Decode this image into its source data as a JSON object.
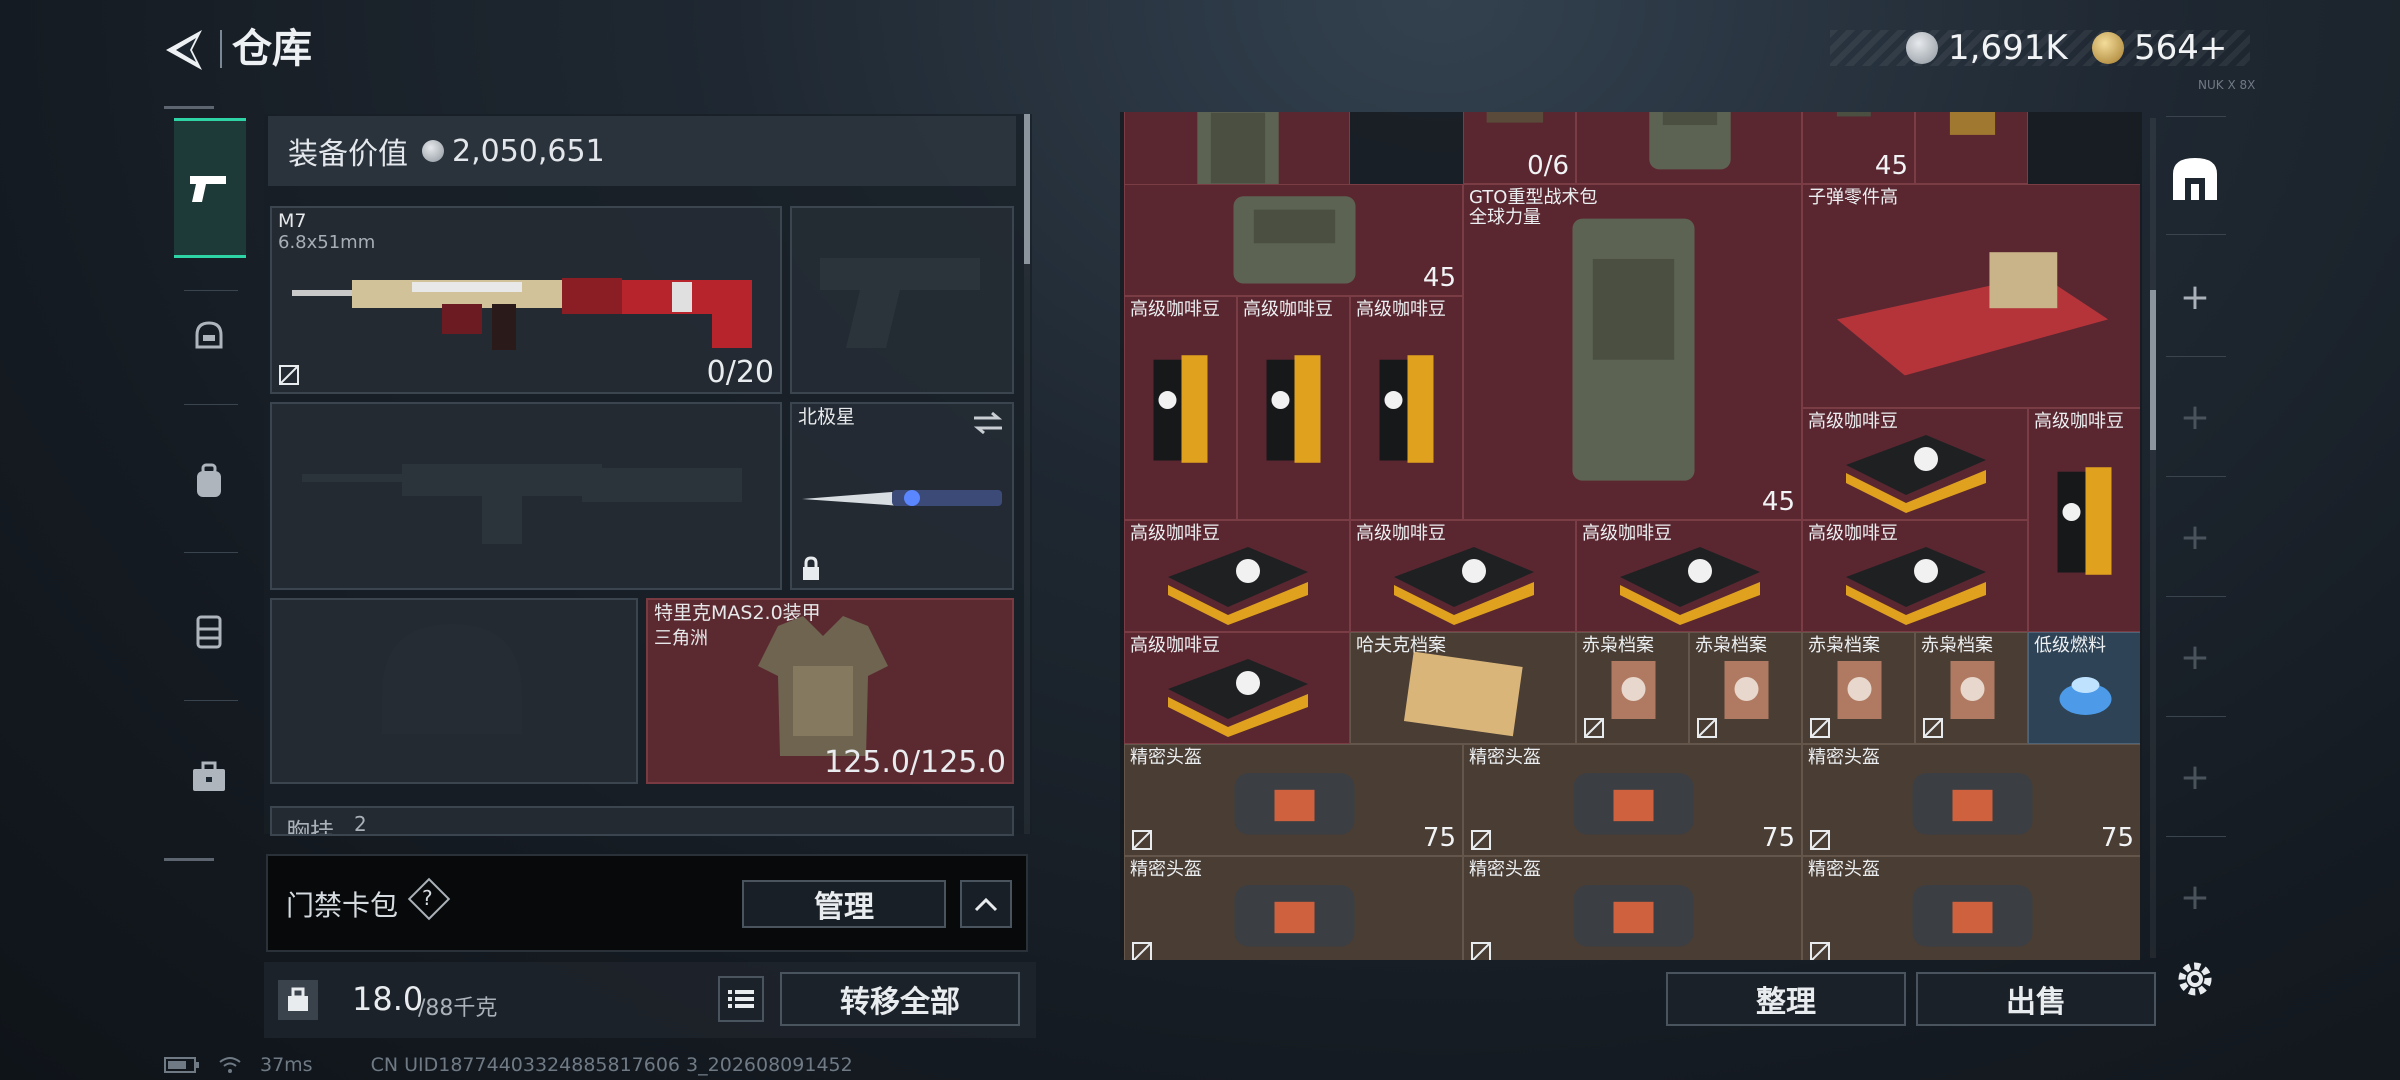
{
  "header": {
    "title": "仓库",
    "currency_silver": "1,691K",
    "currency_gold": "564+",
    "tiny_label": "NUK X 8X"
  },
  "left": {
    "equipment_value_label": "装备价值",
    "equipment_value": "2,050,651",
    "primary_weapon": {
      "name": "M7",
      "caliber": "6.8x51mm",
      "ammo": "0/20"
    },
    "melee": {
      "name": "北极星"
    },
    "armor": {
      "name": "特里克MAS2.0装甲",
      "subtitle": "三角洲",
      "durability": "125.0/125.0"
    },
    "chest_rig_label": "胸挂",
    "chest_rig_count": "2",
    "card_bag_label": "门禁卡包",
    "card_bag_help": "?",
    "manage_button": "管理",
    "weight_current": "18.0",
    "weight_max": "/88千克",
    "transfer_all_button": "转移全部"
  },
  "grid": {
    "items": [
      {
        "label": "",
        "count": "",
        "kind": "backpack"
      },
      {
        "label": "",
        "count": "0/6",
        "kind": "revolver"
      },
      {
        "label": "",
        "count": "",
        "kind": "backpack"
      },
      {
        "label": "",
        "count": "45",
        "kind": "counter"
      },
      {
        "label": "",
        "count": "",
        "kind": "ammo"
      },
      {
        "label": "",
        "count": "45",
        "kind": "backpack"
      },
      {
        "label": "GTO重型战术包",
        "sublabel": "全球力量",
        "count": "45",
        "kind": "backpack"
      },
      {
        "label": "子弹零件高",
        "count": "",
        "kind": "ammo-box"
      },
      {
        "label": "高级咖啡豆",
        "count": "",
        "kind": "coffee"
      },
      {
        "label": "高级咖啡豆",
        "count": "",
        "kind": "coffee"
      },
      {
        "label": "高级咖啡豆",
        "count": "",
        "kind": "coffee"
      },
      {
        "label": "高级咖啡豆",
        "count": "",
        "kind": "coffee-flat"
      },
      {
        "label": "高级咖啡豆",
        "count": "",
        "kind": "coffee"
      },
      {
        "label": "高级咖啡豆",
        "count": "",
        "kind": "coffee-flat"
      },
      {
        "label": "高级咖啡豆",
        "count": "",
        "kind": "coffee-flat"
      },
      {
        "label": "高级咖啡豆",
        "count": "",
        "kind": "coffee-flat"
      },
      {
        "label": "高级咖啡豆",
        "count": "",
        "kind": "coffee-flat"
      },
      {
        "label": "高级咖啡豆",
        "count": "",
        "kind": "coffee-flat"
      },
      {
        "label": "哈夫克档案",
        "count": "",
        "kind": "folder"
      },
      {
        "label": "赤枭档案",
        "count": "",
        "kind": "file"
      },
      {
        "label": "赤枭档案",
        "count": "",
        "kind": "file"
      },
      {
        "label": "赤枭档案",
        "count": "",
        "kind": "file"
      },
      {
        "label": "赤枭档案",
        "count": "",
        "kind": "file"
      },
      {
        "label": "低级燃料",
        "count": "",
        "kind": "fuel"
      },
      {
        "label": "精密头盔",
        "count": "75",
        "kind": "bag"
      },
      {
        "label": "精密头盔",
        "count": "75",
        "kind": "bag"
      },
      {
        "label": "精密头盔",
        "count": "75",
        "kind": "bag"
      },
      {
        "label": "精密头盔",
        "count": "",
        "kind": "bag"
      },
      {
        "label": "精密头盔",
        "count": "",
        "kind": "bag"
      },
      {
        "label": "精密头盔",
        "count": "",
        "kind": "bag"
      }
    ],
    "sort_button": "整理",
    "sell_button": "出售"
  },
  "footer": {
    "ping": "37ms",
    "uid": "CN UID18774403324885817606 3_202608091452"
  },
  "colors": {
    "accent": "#2fd4a6",
    "cell_red": "#5a2731",
    "cell_brown": "#4a3d34",
    "cell_blue": "#2e4355"
  }
}
